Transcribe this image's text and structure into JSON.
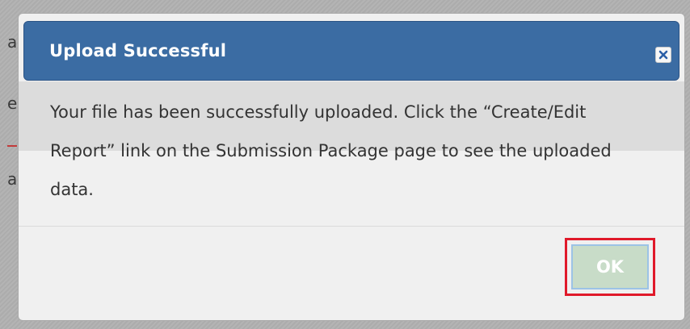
{
  "background": {
    "fragments": [
      "a",
      "e",
      "a"
    ]
  },
  "dialog": {
    "title": "Upload Successful",
    "close_icon": "close-icon",
    "message": "Your file has been successfully uploaded. Click the “Create/Edit Report” link on the Submission Package page to see the uploaded data.",
    "ok_label": "OK"
  },
  "colors": {
    "titlebar": "#3b6ca3",
    "dialog_bg": "#f0f0f0",
    "ok_button_bg": "#c8dcc8",
    "highlight": "#e0192a"
  }
}
